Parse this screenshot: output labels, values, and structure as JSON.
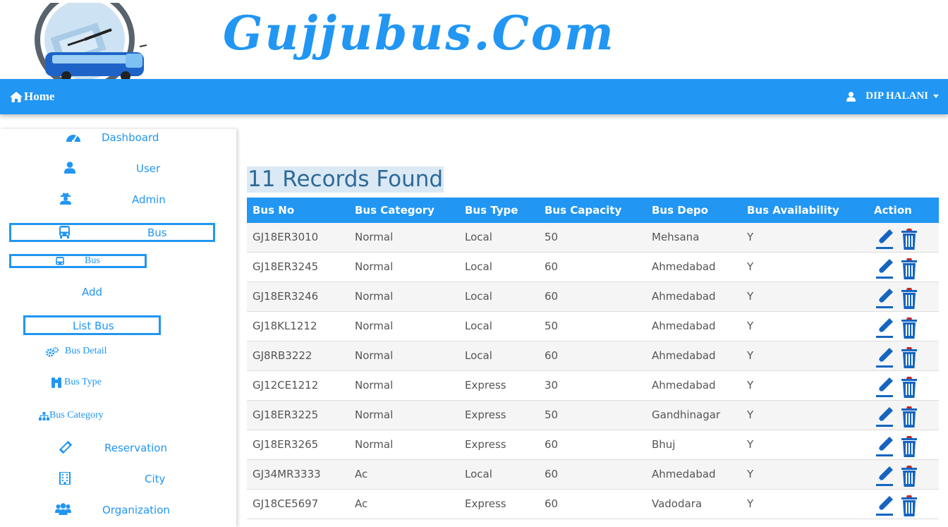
{
  "brand": {
    "name": "Gujjubus.Com"
  },
  "navbar": {
    "home_label": "Home",
    "user_name": "DIP HALANI"
  },
  "sidebar": {
    "dashboard": "Dashboard",
    "user": "User",
    "admin": "Admin",
    "bus": "Bus",
    "bus_sub": "Bus",
    "add": "Add",
    "list_bus": "List Bus",
    "bus_detail": "Bus Detail",
    "bus_type": "Bus Type",
    "bus_category": "Bus Category",
    "reservation": "Reservation",
    "city": "City",
    "organization": "Organization"
  },
  "main": {
    "records_found": "11 Records Found",
    "columns": [
      "Bus No",
      "Bus Category",
      "Bus Type",
      "Bus Capacity",
      "Bus Depo",
      "Bus Availability",
      "Action"
    ],
    "rows": [
      [
        "GJ18ER3010",
        "Normal",
        "Local",
        "50",
        "Mehsana",
        "Y"
      ],
      [
        "GJ18ER3245",
        "Normal",
        "Local",
        "60",
        "Ahmedabad",
        "Y"
      ],
      [
        "GJ18ER3246",
        "Normal",
        "Local",
        "60",
        "Ahmedabad",
        "Y"
      ],
      [
        "GJ18KL1212",
        "Normal",
        "Local",
        "50",
        "Ahmedabad",
        "Y"
      ],
      [
        "GJ8RB3222",
        "Normal",
        "Local",
        "60",
        "Ahmedabad",
        "Y"
      ],
      [
        "GJ12CE1212",
        "Normal",
        "Express",
        "30",
        "Ahmedabad",
        "Y"
      ],
      [
        "GJ18ER3225",
        "Normal",
        "Express",
        "50",
        "Gandhinagar",
        "Y"
      ],
      [
        "GJ18ER3265",
        "Normal",
        "Express",
        "60",
        "Bhuj",
        "Y"
      ],
      [
        "GJ34MR3333",
        "Ac",
        "Local",
        "60",
        "Ahmedabad",
        "Y"
      ],
      [
        "GJ18CE5697",
        "Ac",
        "Express",
        "60",
        "Vadodara",
        "Y"
      ]
    ]
  },
  "colors": {
    "primary": "#2196f3",
    "records_bg": "#dbe9f4",
    "records_text": "#2e6a98",
    "action": "#1565c0"
  }
}
